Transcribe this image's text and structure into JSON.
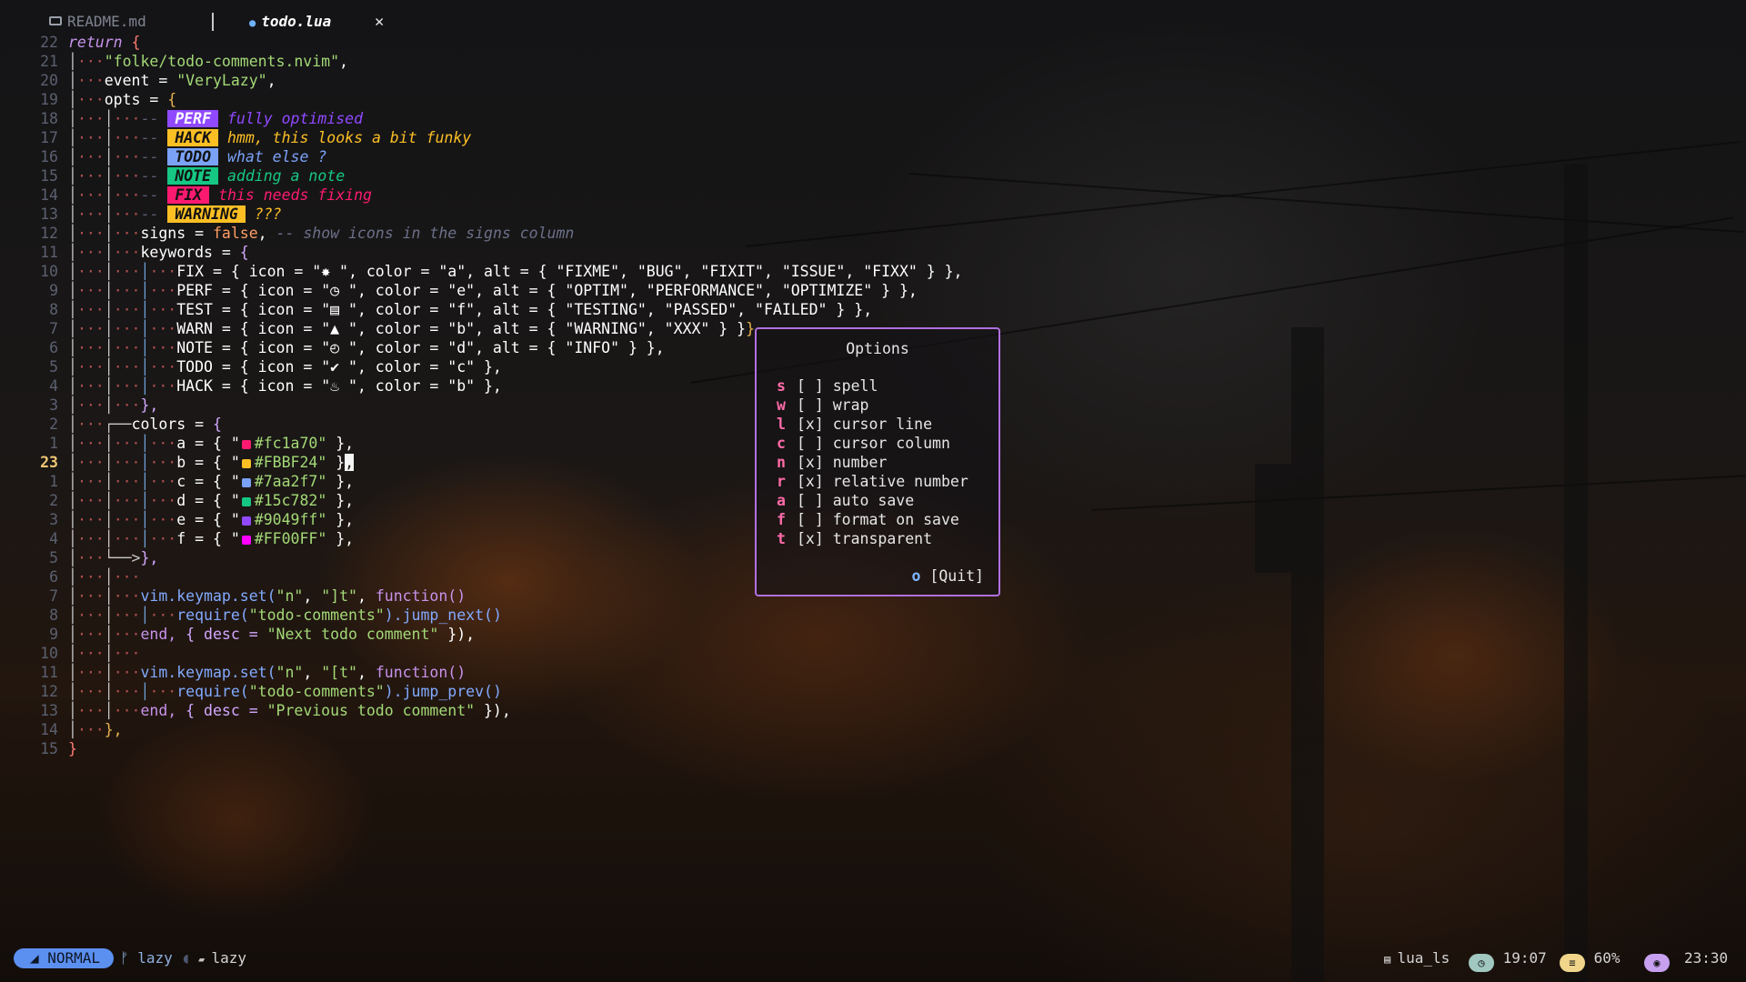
{
  "tabs": [
    {
      "label": "README.md",
      "icon": "markdown-icon",
      "active": false
    },
    {
      "label": "todo.lua",
      "icon": "lua-icon",
      "active": true,
      "close": "✕"
    }
  ],
  "editor": {
    "cursor_line": 23,
    "line_numbers": [
      "22",
      "21",
      "20",
      "19",
      "18",
      "17",
      "16",
      "15",
      "14",
      "13",
      "12",
      "11",
      "10",
      "9",
      "8",
      "7",
      "6",
      "5",
      "4",
      "3",
      "2",
      "1",
      "23",
      "1",
      "2",
      "3",
      "4",
      "5",
      "6",
      "7",
      "8",
      "9",
      "10",
      "11",
      "12",
      "13",
      "14",
      "15"
    ],
    "code": {
      "l22_kw": "return",
      "l22_br": "{",
      "l21_str": "\"folke/todo-comments.nvim\"",
      "l20_id": "event = ",
      "l20_str": "\"VeryLazy\"",
      "l19_id": "opts = ",
      "l19_br": "{",
      "dash": "--",
      "tag_perf": "PERF",
      "tag_hack": "HACK",
      "tag_todo": "TODO",
      "tag_note": "NOTE",
      "tag_fix": "FIX",
      "tag_warning": "WARNING",
      "msg_perf": "fully optimised",
      "msg_hack": "hmm, this looks a bit funky",
      "msg_todo": "what else ?",
      "msg_note": "adding a note",
      "msg_fix": "this needs fixing",
      "msg_warning": "???",
      "l12_id": "signs = ",
      "l12_bool": "false",
      "l12_comma": ", ",
      "l12_cm": "-- show icons in the signs column",
      "l11_id": "keywords = ",
      "kw_fix": "FIX = { icon = \"✸ \", color = \"a\", alt = { \"FIXME\", \"BUG\", \"FIXIT\", \"ISSUE\", \"FIXX\" } },",
      "kw_perf": "PERF = { icon = \"◷ \", color = \"e\", alt = { \"OPTIM\", \"PERFORMANCE\", \"OPTIMIZE\" } },",
      "kw_test": "TEST = { icon = \"▤ \", color = \"f\", alt = { \"TESTING\", \"PASSED\", \"FAILED\" } },",
      "kw_warn": "WARN = { icon = \"▲ \", color = \"b\", alt = { \"WARNING\", \"XXX\" } }",
      "kw_note": "NOTE = { icon = \"◴ \", color = \"d\", alt = { \"INFO\" } },",
      "kw_todo": "TODO = { icon = \"✔ \", color = \"c\" },",
      "kw_hack": "HACK = { icon = \"♨ \", color = \"b\" },",
      "close_brace_comma": "},",
      "colors_id": "colors = ",
      "color_a_key": "a = { \"",
      "color_b_key": "b = { \"",
      "color_c_key": "c = { \"",
      "color_d_key": "d = { \"",
      "color_e_key": "e = { \"",
      "color_f_key": "f = { \"",
      "color_a": "#fc1a70\"",
      "color_b": "#FBBF24\"",
      "color_c": "#7aa2f7\"",
      "color_d": "#15c782\"",
      "color_e": "#9049ff\"",
      "color_f": "#FF00FF\"",
      "color_tail": " },",
      "map_set": "vim.keymap.set(",
      "map_n": "\"n\"",
      "map_next_key": "\"]t\"",
      "map_prev_key": "\"[t\"",
      "map_function": "function()",
      "require": "require(",
      "require_arg": "\"todo-comments\"",
      "jump_next": ").jump_next()",
      "jump_prev": ").jump_prev()",
      "end_kw": "end, ",
      "desc_next_pre": "{ desc = ",
      "desc_next": "\"Next todo comment\"",
      "desc_prev": "\"Previous todo comment\"",
      "desc_post": " }),",
      "l14_close": "},",
      "l15_close": "}"
    },
    "swatch_colors": {
      "a": "#fc1a70",
      "b": "#FBBF24",
      "c": "#7aa2f7",
      "d": "#15c782",
      "e": "#9049ff",
      "f": "#FF00FF"
    }
  },
  "options_popup": {
    "title": "Options",
    "items": [
      {
        "key": "s",
        "state": "[ ]",
        "label": "spell"
      },
      {
        "key": "w",
        "state": "[ ]",
        "label": "wrap"
      },
      {
        "key": "l",
        "state": "[x]",
        "label": "cursor line"
      },
      {
        "key": "c",
        "state": "[ ]",
        "label": "cursor column"
      },
      {
        "key": "n",
        "state": "[x]",
        "label": "number"
      },
      {
        "key": "r",
        "state": "[x]",
        "label": "relative number"
      },
      {
        "key": "a",
        "state": "[ ]",
        "label": "auto save"
      },
      {
        "key": "f",
        "state": "[ ]",
        "label": "format on save"
      },
      {
        "key": "t",
        "state": "[x]",
        "label": "transparent"
      }
    ],
    "quit_key": "o",
    "quit_label": "[Quit]",
    "border_color": "#b070e0"
  },
  "statusline": {
    "mode": "NORMAL",
    "branch": "lazy",
    "directory": "lazy",
    "lsp": "lua_ls",
    "time": "19:07",
    "percent": "60%",
    "clock": "23:30",
    "mode_color": "#5b8ff0"
  }
}
